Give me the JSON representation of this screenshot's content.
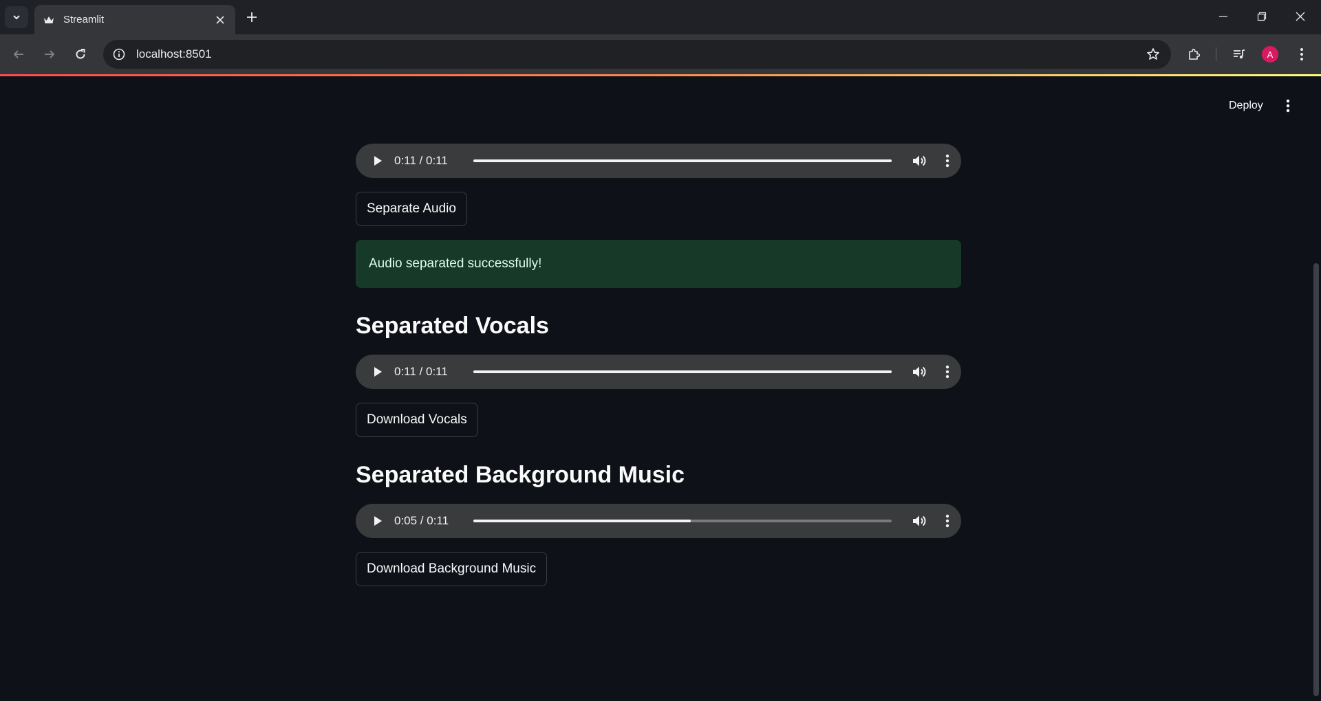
{
  "browser": {
    "tab_title": "Streamlit",
    "url": "localhost:8501",
    "profile_initial": "A"
  },
  "colors": {
    "page_background": "#0e1117",
    "success_background": "#173928",
    "success_text": "#dffde9",
    "audio_player_background": "#3a3b3d",
    "accent_gradient_start": "#ff4b4b",
    "accent_gradient_end": "#fffd80",
    "avatar": "#d81b60"
  },
  "header": {
    "deploy_label": "Deploy"
  },
  "main": {
    "input_audio": {
      "time": "0:11 / 0:11",
      "progress": 1.0
    },
    "separate_button": "Separate Audio",
    "success_message": "Audio separated successfully!",
    "vocals": {
      "heading": "Separated Vocals",
      "player": {
        "time": "0:11 / 0:11",
        "progress": 1.0
      },
      "download_button": "Download Vocals"
    },
    "background_music": {
      "heading": "Separated Background Music",
      "player": {
        "time": "0:05 / 0:11",
        "progress": 0.52
      },
      "download_button": "Download Background Music"
    }
  }
}
